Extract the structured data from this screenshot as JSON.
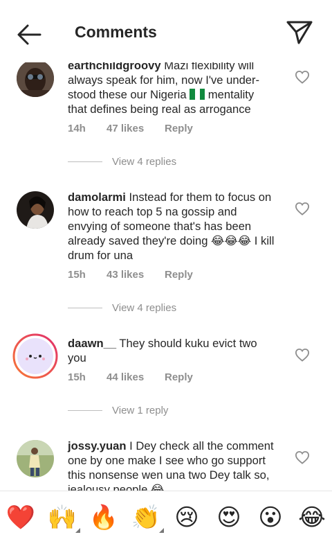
{
  "header": {
    "title": "Comments"
  },
  "comments": [
    {
      "username": "earthchildgroovy",
      "text": " Mazi flexibility will always speak for him, now I've under-stood these our Nigeria ",
      "flag": "Nigeria flag",
      "text_after": " mentality that defines being real as arrogance",
      "time": "14h",
      "likes": "47 likes",
      "reply": "Reply",
      "view_replies": "View 4 replies"
    },
    {
      "username": "damolarmi",
      "text": " Instead for them to focus on how to reach top 5 na gossip and envying of someone that's has been already saved they're doing 😂😂😂 I kill drum for una",
      "time": "15h",
      "likes": "43 likes",
      "reply": "Reply",
      "view_replies": "View 4 replies"
    },
    {
      "username": "daawn__",
      "text": " They should kuku evict two you",
      "time": "15h",
      "likes": "44 likes",
      "reply": "Reply",
      "view_replies": "View 1 reply"
    },
    {
      "username": "jossy.yuan",
      "text": " I Dey check all the comment one by one make I see who go support this nonsense wen una two Dey talk so, jealousy people 😂"
    }
  ],
  "emoji_bar": [
    {
      "glyph": "❤️",
      "name": "red-heart"
    },
    {
      "glyph": "🙌",
      "name": "raising-hands"
    },
    {
      "glyph": "🔥",
      "name": "fire"
    },
    {
      "glyph": "👏",
      "name": "clapping-hands"
    },
    {
      "glyph": "😢",
      "name": "crying-face"
    },
    {
      "glyph": "😍",
      "name": "heart-eyes"
    },
    {
      "glyph": "😮",
      "name": "open-mouth"
    },
    {
      "glyph": "😂",
      "name": "tears-of-joy"
    }
  ],
  "colors": {
    "text": "#262626",
    "muted": "#8e8e8e",
    "story_ring_start": "#e1306c",
    "story_ring_end": "#f77737"
  }
}
